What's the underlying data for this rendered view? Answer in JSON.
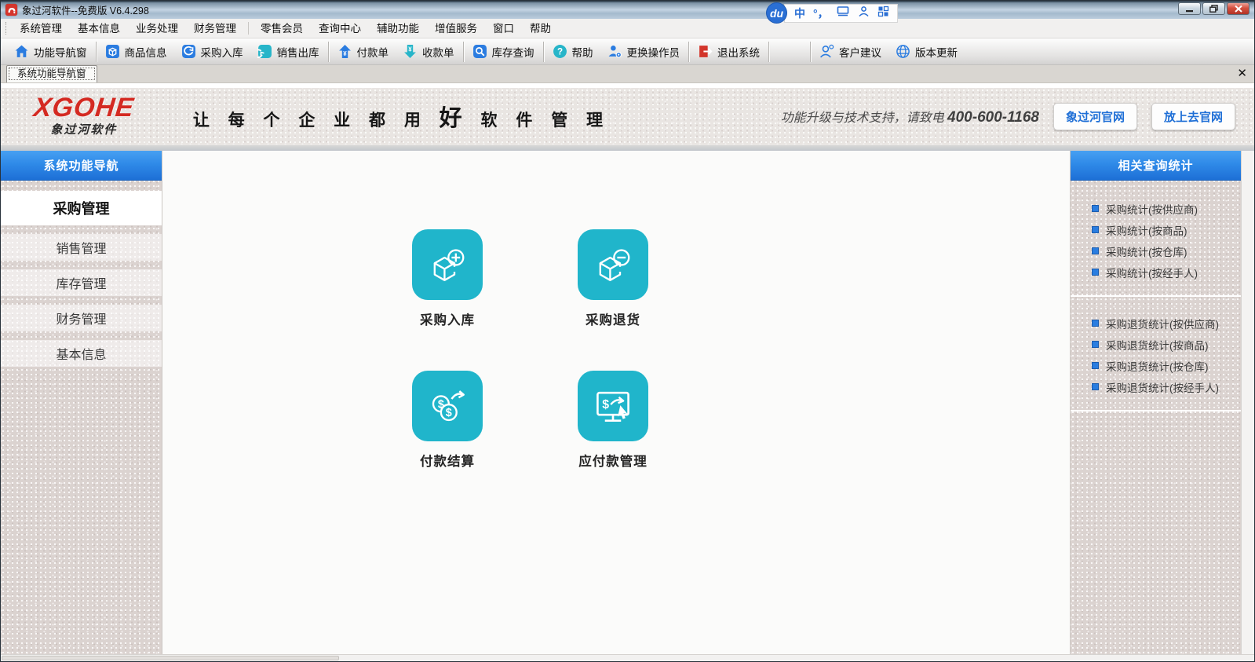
{
  "window": {
    "title": "象过河软件--免费版 V6.4.298",
    "tab_close": "✕"
  },
  "ime": {
    "logo": "du",
    "lang": "中",
    "punct": "°，"
  },
  "menu": {
    "items": [
      "系统管理",
      "基本信息",
      "业务处理",
      "财务管理",
      "零售会员",
      "查询中心",
      "辅助功能",
      "增值服务",
      "窗口",
      "帮助"
    ]
  },
  "toolbar": {
    "items": [
      {
        "label": "功能导航窗",
        "icon": "home-icon"
      },
      {
        "label": "商品信息",
        "icon": "goods-icon"
      },
      {
        "label": "采购入库",
        "icon": "purchase-in-icon"
      },
      {
        "label": "销售出库",
        "icon": "sales-out-icon"
      },
      {
        "label": "付款单",
        "icon": "payment-icon"
      },
      {
        "label": "收款单",
        "icon": "receipt-icon"
      },
      {
        "label": "库存查询",
        "icon": "inventory-query-icon"
      },
      {
        "label": "帮助",
        "icon": "help-icon"
      },
      {
        "label": "更换操作员",
        "icon": "switch-operator-icon"
      },
      {
        "label": "退出系统",
        "icon": "exit-icon"
      },
      {
        "label": "客户建议",
        "icon": "suggestion-icon"
      },
      {
        "label": "版本更新",
        "icon": "update-icon"
      }
    ]
  },
  "tab": {
    "label": "系统功能导航窗"
  },
  "banner": {
    "logo_text": "XGOHE",
    "logo_sub": "象过河软件",
    "slogan_left": "让 每 个 企 业 都 用",
    "slogan_em": "好",
    "slogan_right": "软 件 管 理",
    "support_prefix": "功能升级与技术支持，请致电 ",
    "support_phone": "400-600-1168",
    "buttons": [
      "象过河官网",
      "放上去官网"
    ]
  },
  "left_sidebar": {
    "header": "系统功能导航",
    "items": [
      {
        "label": "采购管理",
        "active": true
      },
      {
        "label": "销售管理",
        "active": false
      },
      {
        "label": "库存管理",
        "active": false
      },
      {
        "label": "财务管理",
        "active": false
      },
      {
        "label": "基本信息",
        "active": false
      }
    ]
  },
  "tiles": [
    {
      "label": "采购入库",
      "icon": "box-plus-icon"
    },
    {
      "label": "采购退货",
      "icon": "box-minus-icon"
    },
    {
      "label": "付款结算",
      "icon": "coins-arrow-icon"
    },
    {
      "label": "应付款管理",
      "icon": "monitor-dollar-icon"
    }
  ],
  "right_sidebar": {
    "header": "相关查询统计",
    "groups": [
      {
        "items": [
          "采购统计(按供应商)",
          "采购统计(按商品)",
          "采购统计(按仓库)",
          "采购统计(按经手人)"
        ]
      },
      {
        "items": [
          "采购退货统计(按供应商)",
          "采购退货统计(按商品)",
          "采购退货统计(按仓库)",
          "采购退货统计(按经手人)"
        ]
      }
    ]
  },
  "colors": {
    "accent_blue": "#2b7ce0",
    "teal": "#20b5cb",
    "brand_red": "#d42a22",
    "header_blue_top": "#47a0f2",
    "header_blue_bottom": "#1d6fd6",
    "exit_red": "#d3352b"
  }
}
